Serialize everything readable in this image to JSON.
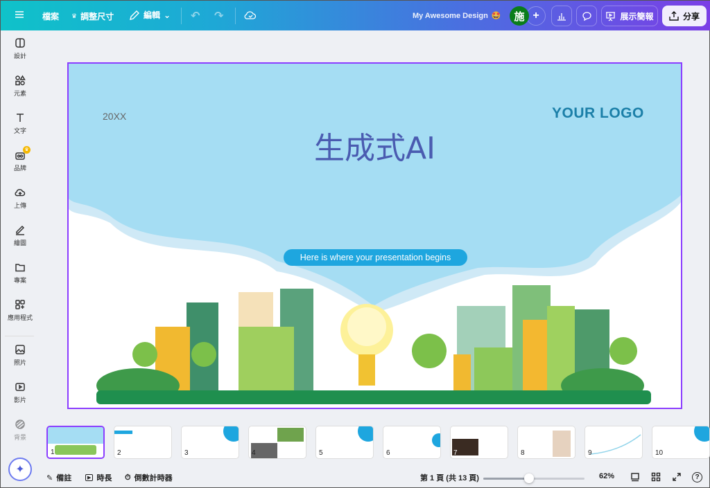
{
  "topbar": {
    "menu_icon": "hamburger-icon",
    "file": "檔案",
    "resize": "調整尺寸",
    "edit": "編輯",
    "design_title": "My Awesome Design",
    "title_emoji": "🤩",
    "avatar_initial": "施",
    "present": "展示簡報",
    "share": "分享"
  },
  "sidebar": {
    "items": [
      {
        "label": "設計",
        "icon": "layout-icon"
      },
      {
        "label": "元素",
        "icon": "shapes-icon"
      },
      {
        "label": "文字",
        "icon": "text-icon"
      },
      {
        "label": "品牌",
        "icon": "brand-icon"
      },
      {
        "label": "上傳",
        "icon": "upload-cloud-icon"
      },
      {
        "label": "繪圖",
        "icon": "draw-icon"
      },
      {
        "label": "專案",
        "icon": "folder-icon"
      },
      {
        "label": "應用程式",
        "icon": "apps-icon"
      },
      {
        "label": "照片",
        "icon": "photo-icon"
      },
      {
        "label": "影片",
        "icon": "video-icon"
      },
      {
        "label": "背景",
        "icon": "background-icon"
      }
    ]
  },
  "slide": {
    "year": "20XX",
    "logo": "YOUR LOGO",
    "title": "生成式AI",
    "subtitle": "Here is where your presentation begins"
  },
  "thumbnails": [
    "1",
    "2",
    "3",
    "4",
    "5",
    "6",
    "7",
    "8",
    "9",
    "10"
  ],
  "selected_page": 1,
  "bottombar": {
    "notes": "備註",
    "duration": "時長",
    "timer": "倒數計時器",
    "page_status": "第 1 頁 (共 13 頁)",
    "zoom": "62%",
    "zoom_value": 62
  },
  "colors": {
    "accent": "#8b3dff",
    "sky": "#a5ddf3",
    "title": "#4a5bb0",
    "pill": "#1ea6df"
  }
}
